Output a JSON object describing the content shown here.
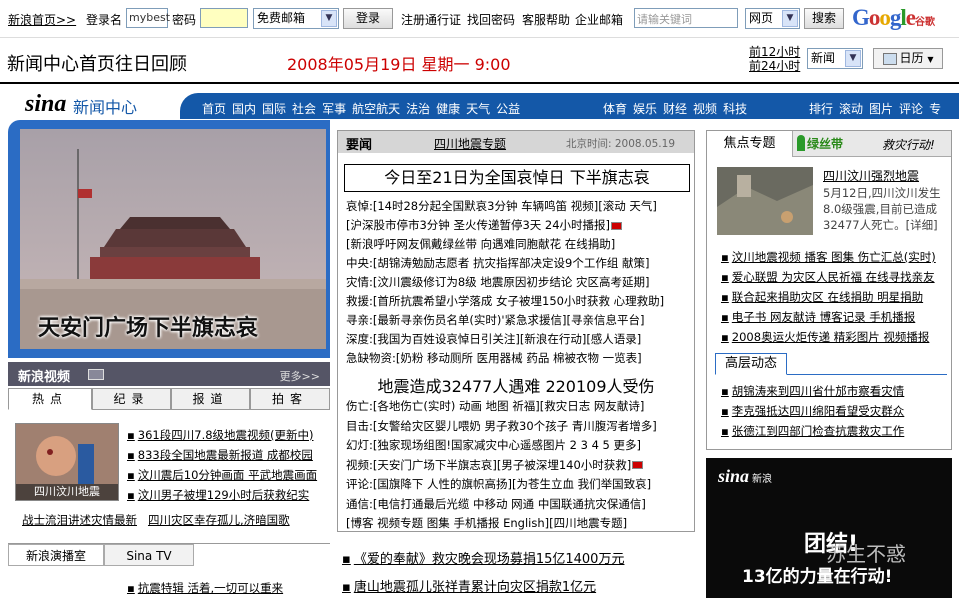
{
  "topbar": {
    "home": "新浪首页>>",
    "login_label": "登录名",
    "login_value": "mybest",
    "password_label": "密码",
    "mail_select": "免费邮箱",
    "login_button": "登录",
    "links": [
      "注册通行证",
      "找回密码",
      "客服帮助",
      "企业邮箱"
    ],
    "search_placeholder": "请输关键词",
    "search_type": "网页",
    "search_button": "搜索",
    "google_text": "Google",
    "google_cn": "谷歌"
  },
  "header": {
    "title": "新闻中心首页往日回顾",
    "date": "2008年05月19日  星期一  9:00",
    "prev12": "前12小时",
    "prev24": "前24小时",
    "channel_select": "新闻",
    "calendar": "日历"
  },
  "nav": {
    "logo": "sina",
    "logo_text": "新闻中心",
    "group1": [
      "首页",
      "国内",
      "国际",
      "社会",
      "军事",
      "航空航天",
      "法治",
      "健康",
      "天气",
      "公益"
    ],
    "group2": [
      "体育",
      "娱乐",
      "财经",
      "视频",
      "科技"
    ],
    "group3": [
      "排行",
      "滚动",
      "图片",
      "评论",
      "专"
    ]
  },
  "hero": {
    "caption": "天安门广场下半旗志哀"
  },
  "video": {
    "title": "新浪视频",
    "more": "更多>>",
    "tabs": [
      "热点",
      "纪录",
      "报道",
      "拍客"
    ],
    "thumb_label": "四川汶川地震",
    "items": [
      "361段四川7.8级地震视频(更新中)",
      "833段全国地震最新报道 成都校园",
      "汶川震后10分钟画面 平武地震画面",
      "汶川男子被埋129小时后获救纪实"
    ],
    "extra": [
      "战士流泪讲述灾情最新",
      "四川灾区幸存孤儿,济暗国歌"
    ]
  },
  "broadcast": {
    "tabs": [
      "新浪演播室",
      "Sina TV"
    ],
    "item": "抗震特辑 活着,一切可以重来"
  },
  "news": {
    "tab_main": "要闻",
    "tab_special": "四川地震专题",
    "bj_time": "北京时间: 2008.05.19",
    "headline": "今日至21日为全国哀悼日 下半旗志哀",
    "lines": [
      "哀悼:[14时28分起全国默哀3分钟 车辆鸣笛 视频][滚动 天气]",
      "     [沪深股市停市3分钟 圣火传递暂停3天 24小时播报]",
      "     [新浪呼吁网友佩戴绿丝带 向遇难同胞献花 在线捐助]",
      "中央:[胡锦涛勉励志愿者 抗灾指挥部决定设9个工作组 献策]",
      "灾情:[汶川震级修订为8级 地震原因初步结论 灾区高考延期]",
      "救援:[首所抗震希望小学落成 女子被埋150小时获救 心理救助]",
      "寻亲:[最新寻亲伤员名单(实时)'紧急求援信][寻亲信息平台]",
      "深度:[我国为百姓设哀悼日引关注][新浪在行动][感人语录]",
      "急缺物资:[奶粉 移动厕所 医用器械 药品 棉被衣物 一览表]"
    ],
    "headline2": "地震造成32477人遇难  220109人受伤",
    "lines2": [
      "伤亡:[各地伤亡(实时) 动画 地图 祈福][救灾日志 网友献诗]",
      "目击:[女警给灾区婴儿喂奶 男子救30个孩子 青川腹泻者增多]",
      "幻灯:[独家现场组图!国家减灾中心遥感图片 2 3 4 5 更多]",
      "视频:[天安门广场下半旗志哀][男子被深埋140小时获救]",
      "评论:[国旗降下 人性的旗帜高扬][为苍生立血 我们举国致哀]",
      "通信:[电信打通最后光缆 中移动 网通 中国联通抗灾保通信]",
      "[博客 视频专题 图集 手机播报 English][四川地震专题]"
    ]
  },
  "below": [
    "《爱的奉献》救灾晚会现场募捐15亿1400万元",
    "唐山地震孤儿张祥青累计向灾区捐款1亿元"
  ],
  "right": {
    "tab": "焦点专题",
    "ribbon": "绿丝带",
    "slogan": "救灾行动!",
    "quake_title": "四川汶川强烈地震",
    "quake_desc": "5月12日,四川汶川发生8.0级强震,目前已造成32477人死亡。[详细]",
    "links": [
      "汶川地震视频 播客 图集 伤亡汇总(实时)",
      "爱心联盟 为灾区人民祈福 在线寻找亲友",
      "联合起来捐助灾区 在线捐助 明星捐助",
      "电子书 网友献诗 博客记录 手机播报",
      "2008奥运火炬传递 精彩图片 视频播报"
    ],
    "gtab": "高层动态",
    "glinks": [
      "胡锦涛来到四川省什邡市察看灾情",
      "李克强抵达四川绵阳看望受灾群众",
      "张德江到四部门检查抗震救灾工作"
    ]
  },
  "ad": {
    "logo": "sina",
    "logo_small": "新浪",
    "line1": "团结!",
    "line2": "13亿的力量在行动!",
    "watermark": "苏生不惑"
  },
  "colors": {
    "nav_blue": "#1458a8",
    "date_red": "#cc0000",
    "ribbon_green": "#2a8a1a"
  }
}
